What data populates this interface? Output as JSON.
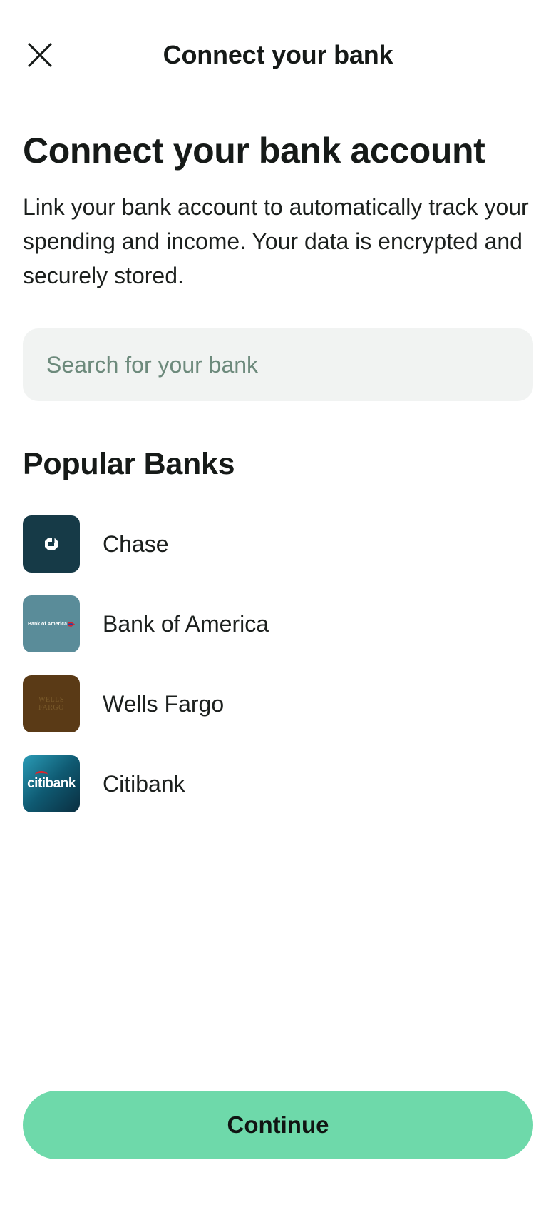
{
  "header": {
    "title": "Connect your bank",
    "close_icon": "close-icon"
  },
  "main": {
    "title": "Connect your bank account",
    "description": "Link your bank account to automatically track your spending and income. Your data is encrypted and securely stored."
  },
  "search": {
    "placeholder": "Search for your bank",
    "value": "",
    "icon": "none"
  },
  "popular_banks": {
    "title": "Popular Banks",
    "items": [
      {
        "name": "Chase",
        "logo_mark": "chase-octagon-logo",
        "logo_color": "#163a47"
      },
      {
        "name": "Bank of America",
        "logo_mark": "boa-wordmark-logo",
        "logo_text": "Bank of America",
        "logo_color": "#5a8c99"
      },
      {
        "name": "Wells Fargo",
        "logo_mark": "wells-fargo-wordmark-logo",
        "logo_text": "WELLS FARGO",
        "logo_color": "#5a3a16"
      },
      {
        "name": "Citibank",
        "logo_mark": "citibank-wordmark-logo",
        "logo_text": "citibank",
        "logo_color": "#0f5a72"
      }
    ]
  },
  "footer": {
    "continue_label": "Continue"
  },
  "colors": {
    "accent": "#6ed9aa",
    "search_bg": "#f1f3f2",
    "placeholder": "#6d8a7c",
    "text": "#161a18"
  }
}
